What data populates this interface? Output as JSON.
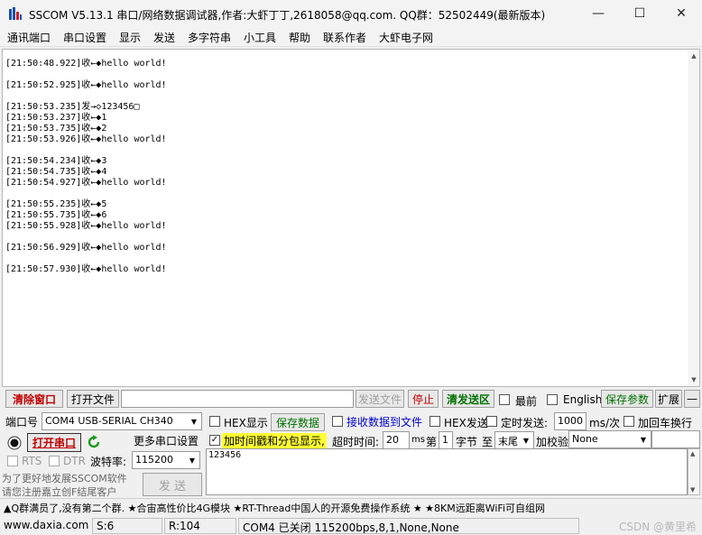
{
  "window": {
    "title": "SSCOM V5.13.1 串口/网络数据调试器,作者:大虾丁丁,2618058@qq.com. QQ群：52502449(最新版本)",
    "min_glyph": "—",
    "max_glyph": "☐",
    "close_glyph": "✕"
  },
  "menu": [
    "通讯端口",
    "串口设置",
    "显示",
    "发送",
    "多字符串",
    "小工具",
    "帮助",
    "联系作者",
    "大虾电子网"
  ],
  "log_lines": [
    {
      "row": 0,
      "text": "[21:50:48.922]收←◆hello world!"
    },
    {
      "row": 2,
      "text": "[21:50:52.925]收←◆hello world!"
    },
    {
      "row": 4,
      "text": "[21:50:53.235]发→◇123456□"
    },
    {
      "row": 5,
      "text": "[21:50:53.237]收←◆1"
    },
    {
      "row": 6,
      "text": "[21:50:53.735]收←◆2"
    },
    {
      "row": 7,
      "text": "[21:50:53.926]收←◆hello world!"
    },
    {
      "row": 9,
      "text": "[21:50:54.234]收←◆3"
    },
    {
      "row": 10,
      "text": "[21:50:54.735]收←◆4"
    },
    {
      "row": 11,
      "text": "[21:50:54.927]收←◆hello world!"
    },
    {
      "row": 13,
      "text": "[21:50:55.235]收←◆5"
    },
    {
      "row": 14,
      "text": "[21:50:55.735]收←◆6"
    },
    {
      "row": 15,
      "text": "[21:50:55.928]收←◆hello world!"
    },
    {
      "row": 17,
      "text": "[21:50:56.929]收←◆hello world!"
    },
    {
      "row": 19,
      "text": "[21:50:57.930]收←◆hello world!"
    }
  ],
  "toolbar": {
    "clear_window": "清除窗口",
    "open_file": "打开文件",
    "file_path": "",
    "send_file": "发送文件",
    "stop": "停止",
    "clear_send": "清发送区",
    "topmost": "最前",
    "english": "English",
    "save_params": "保存参数",
    "expand": "扩展",
    "collapse": "—"
  },
  "port": {
    "port_label": "端口号",
    "port_value": "COM4 USB-SERIAL CH340",
    "open_port": "打开串口",
    "more_settings": "更多串口设置",
    "rts": "RTS",
    "dtr": "DTR",
    "baud_label": "波特率:",
    "baud_value": "115200"
  },
  "options": {
    "hex_display": "HEX显示",
    "save_data": "保存数据",
    "recv_to_file": "接收数据到文件",
    "hex_send": "HEX发送",
    "timed_send": "定时发送:",
    "interval_value": "1000",
    "interval_unit": "ms/次",
    "add_crlf": "加回车换行",
    "timestamp": "加时间戳和分包显示,",
    "timeout_label": "超时时间:",
    "timeout_value": "20",
    "timeout_unit": "ms",
    "byte_prefix": "第",
    "byte_value": "1",
    "byte_label": "字节",
    "to_label": "至",
    "end_value": "末尾",
    "checksum_label": "加校验",
    "checksum_value": "None"
  },
  "send": {
    "text": "123456",
    "send_button": "发 送",
    "promo_1": "为了更好地发展SSCOM软件",
    "promo_2": "请您注册嘉立创F结尾客户"
  },
  "ticker": "▲Q群满员了,没有第二个群. ★合宙高性价比4G模块 ★RT-Thread中国人的开源免费操作系统 ★ ★8KM远距离WiFi可自组网",
  "status": {
    "site": "www.daxia.com",
    "sent": "S:6",
    "received": "R:104",
    "port_state": "COM4 已关闭  115200bps,8,1,None,None",
    "watermark": "CSDN @黄里希"
  },
  "colors": {
    "clear_window": "#c00000",
    "green_button": "#007000",
    "highlight": "#ffff33"
  }
}
